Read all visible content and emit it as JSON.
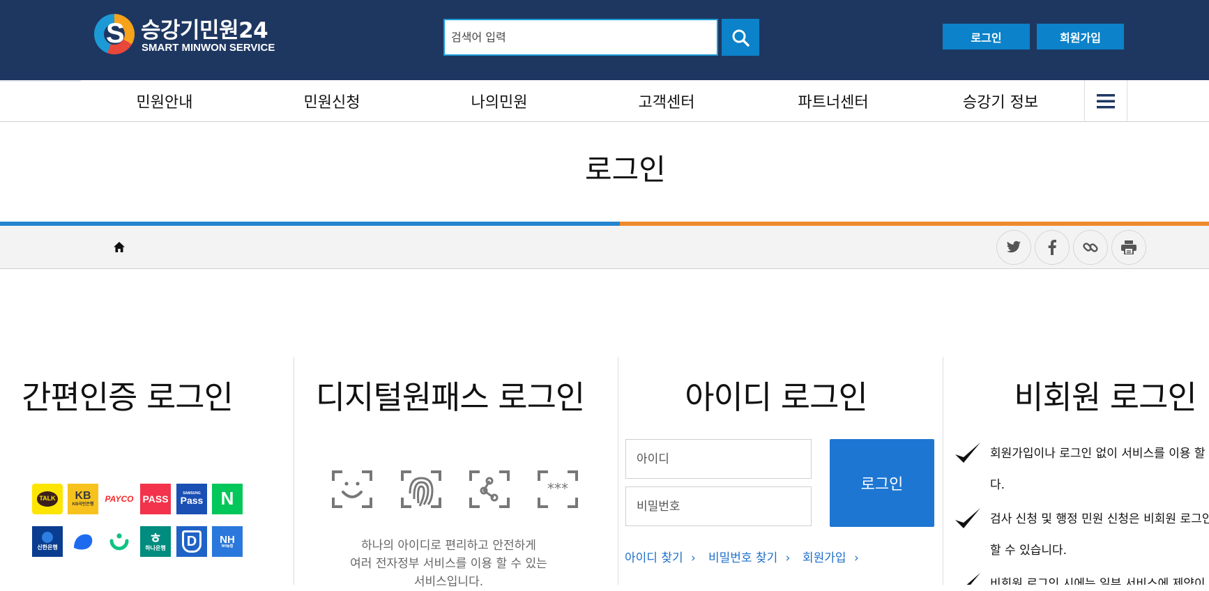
{
  "header": {
    "logo_title": "승강기민원24",
    "logo_subtitle": "SMART MINWON SERVICE",
    "search_placeholder": "검색어 입력",
    "login_label": "로그인",
    "join_label": "회원가입"
  },
  "nav": {
    "items": [
      {
        "label": "민원안내"
      },
      {
        "label": "민원신청"
      },
      {
        "label": "나의민원"
      },
      {
        "label": "고객센터"
      },
      {
        "label": "파트너센터"
      },
      {
        "label": "승강기 정보"
      }
    ]
  },
  "page": {
    "title": "로그인"
  },
  "colors": {
    "header_bg": "#1e3761",
    "accent_blue": "#0b82c9",
    "login_button": "#1e76d3",
    "bar_blue": "#2385cf",
    "bar_orange": "#ee8a2c",
    "link": "#1e6fc8"
  },
  "simple_auth": {
    "title": "간편인증 로그인",
    "providers": [
      {
        "label": "TALK",
        "icon": "kakao-talk-icon"
      },
      {
        "label": "KB",
        "sublabel": "KB국민은행",
        "icon": "kb-bank-icon"
      },
      {
        "label": "PAYCO",
        "icon": "payco-icon"
      },
      {
        "label": "PASS",
        "icon": "pass-icon"
      },
      {
        "label": "Pass",
        "sublabel": "SAMSUNG",
        "icon": "samsung-pass-icon"
      },
      {
        "label": "N",
        "icon": "naver-icon"
      },
      {
        "label": "신한은행",
        "icon": "shinhan-bank-icon"
      },
      {
        "label": "",
        "icon": "toss-icon"
      },
      {
        "label": "",
        "icon": "banksalad-icon"
      },
      {
        "label": "하나은행",
        "icon": "hana-bank-icon"
      },
      {
        "label": "D",
        "icon": "d-shield-icon"
      },
      {
        "label": "NH",
        "icon": "nh-bank-icon"
      }
    ]
  },
  "digital_onepass": {
    "title": "디지털원패스 로그인",
    "icons": [
      "face-scan-icon",
      "fingerprint-icon",
      "pattern-icon",
      "pin-icon"
    ],
    "desc_line1": "하나의 아이디로 편리하고 안전하게",
    "desc_line2": "여러 전자정부 서비스를 이용 할 수 있는",
    "desc_line3": "서비스입니다."
  },
  "id_login": {
    "title": "아이디 로그인",
    "id_placeholder": "아이디",
    "pw_placeholder": "비밀번호",
    "button_label": "로그인",
    "links": [
      {
        "label": "아이디 찾기"
      },
      {
        "label": "비밀번호 찾기"
      },
      {
        "label": "회원가입"
      }
    ]
  },
  "non_member": {
    "title": "비회원 로그인",
    "items": [
      {
        "line1": "회원가입이나 로그인 없이 서비스를 이용 할 수",
        "line2": "다."
      },
      {
        "line1": "검사 신청 및 행정 민원 신청은 비회원 로그인으",
        "line2": "할 수 있습니다."
      },
      {
        "line1": "비회원 로그인 시에는 일부 서비스에 제약이 있"
      }
    ]
  }
}
